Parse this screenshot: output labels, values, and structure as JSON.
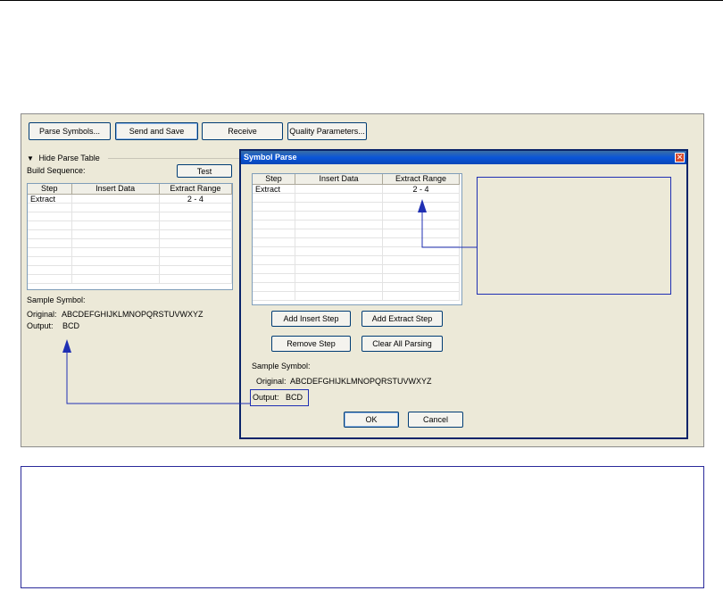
{
  "toolbar": {
    "parse_symbols_label": "Parse Symbols...",
    "send_and_save_label": "Send and Save",
    "receive_label": "Receive",
    "quality_parameters_label": "Quality Parameters..."
  },
  "left_panel": {
    "hide_parse_table_label": "Hide Parse Table",
    "build_sequence_label": "Build Sequence:",
    "test_label": "Test",
    "columns": [
      "Step",
      "Insert Data",
      "Extract Range"
    ],
    "rows": [
      [
        "Extract",
        "",
        "2 - 4"
      ]
    ],
    "sample_symbol_label": "Sample Symbol:",
    "original_label": "Original:",
    "original_value": "ABCDEFGHIJKLMNOPQRSTUVWXYZ",
    "output_label": "Output:",
    "output_value": "BCD"
  },
  "dialog": {
    "title": "Symbol Parse",
    "close_glyph": "✕",
    "columns": [
      "Step",
      "Insert Data",
      "Extract Range"
    ],
    "rows": [
      [
        "Extract",
        "",
        "2 - 4"
      ]
    ],
    "add_insert_step_label": "Add Insert Step",
    "add_extract_step_label": "Add Extract Step",
    "remove_step_label": "Remove Step",
    "clear_all_parsing_label": "Clear All Parsing",
    "sample_symbol_label": "Sample Symbol:",
    "original_label": "Original:",
    "original_value": "ABCDEFGHIJKLMNOPQRSTUVWXYZ",
    "output_label": "Output:",
    "output_value": "BCD",
    "ok_label": "OK",
    "cancel_label": "Cancel"
  },
  "colors": {
    "annotation_blue": "#1f2fb3",
    "dialog_title_blue": "#0a55d8",
    "panel_bg": "#ece9d8"
  }
}
